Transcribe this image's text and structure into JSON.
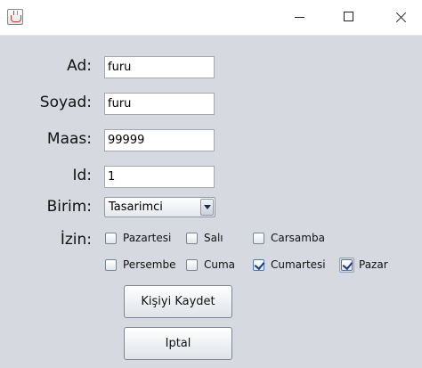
{
  "window": {
    "icon": "java-cup-icon",
    "controls": [
      "minimize-icon",
      "maximize-icon",
      "close-icon"
    ]
  },
  "form": {
    "ad": {
      "label": "Ad:",
      "value": "furu"
    },
    "soyad": {
      "label": "Soyad:",
      "value": "furu"
    },
    "maas": {
      "label": "Maas:",
      "value": "99999"
    },
    "id": {
      "label": "Id:",
      "value": "1"
    },
    "birim": {
      "label": "Birim:",
      "selected": "Tasarimci"
    },
    "izin": {
      "label": "İzin:",
      "days": [
        {
          "label": "Pazartesi",
          "checked": false
        },
        {
          "label": "Salı",
          "checked": false
        },
        {
          "label": "Carsamba",
          "checked": false
        },
        {
          "label": "Persembe",
          "checked": false
        },
        {
          "label": "Cuma",
          "checked": false
        },
        {
          "label": "Cumartesi",
          "checked": true
        },
        {
          "label": "Pazar",
          "checked": true
        }
      ]
    }
  },
  "buttons": {
    "save": "Kişiyi Kaydet",
    "cancel": "Iptal"
  }
}
